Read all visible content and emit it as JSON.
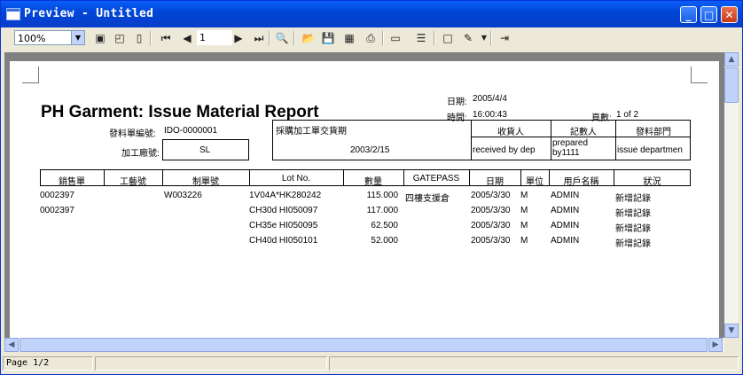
{
  "window": {
    "title": "Preview - Untitled"
  },
  "toolbar": {
    "zoom": "100%",
    "page_number": "1"
  },
  "status": {
    "page": "Page 1/2"
  },
  "report": {
    "title": "PH Garment: Issue Material Report",
    "date_label": "日期:",
    "date_value": "2005/4/4",
    "time_label": "時間:",
    "time_value": "16:00:43",
    "page_label": "頁數:",
    "page_value": "1 of 2",
    "issue_no_label": "發料單編號:",
    "issue_no_value": "IDO-0000001",
    "factory_label": "加工廠號:",
    "factory_value": "SL",
    "purchase_label": "採購加工單交貨期",
    "purchase_value": "2003/2/15",
    "receiver_label": "收貨人",
    "receiver_value": "received by dep",
    "preparer_label": "記數人",
    "preparer_value": "prepared by1111",
    "dept_label": "發料部門",
    "dept_value": "issue departmen",
    "columns": [
      "銷售單",
      "工藝號",
      "制單號",
      "Lot No.",
      "數量",
      "GATEPASS",
      "日期",
      "單位",
      "用戶名稱",
      "狀況"
    ],
    "rows": [
      [
        "0002397",
        "",
        "W003226",
        "1V04A*HK280242",
        "115.000",
        "四樓支援倉",
        "2005/3/30",
        "M",
        "ADMIN",
        "新增記錄"
      ],
      [
        "0002397",
        "",
        "",
        "CH30d HI050097",
        "117.000",
        "",
        "2005/3/30",
        "M",
        "ADMIN",
        "新增記錄"
      ],
      [
        "",
        "",
        "",
        "CH35e HI050095",
        "62.500",
        "",
        "2005/3/30",
        "M",
        "ADMIN",
        "新增記錄"
      ],
      [
        "",
        "",
        "",
        "CH40d HI050101",
        "52.000",
        "",
        "2005/3/30",
        "M",
        "ADMIN",
        "新增記錄"
      ]
    ]
  }
}
